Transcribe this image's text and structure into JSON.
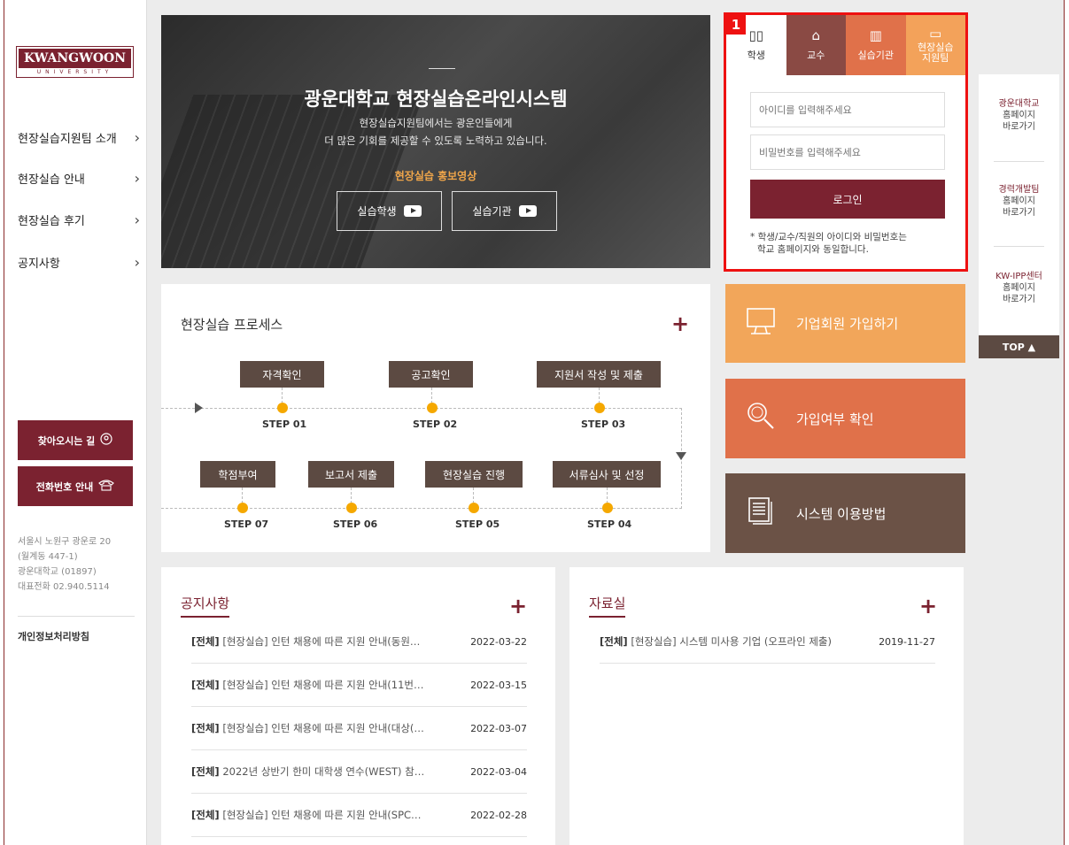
{
  "sidebar": {
    "logo_text": "KWANGWOON",
    "logo_sub": "UNIVERSITY",
    "nav": [
      "현장실습지원팀 소개",
      "현장실습 안내",
      "현장실습 후기",
      "공지사항"
    ],
    "directions_label": "찾아오시는 길",
    "phone_label": "전화번호 안내",
    "address": [
      "서울시 노원구 광운로 20",
      "(월계동 447-1)",
      "광운대학교 (01897)",
      "대표전화 02.940.5114"
    ],
    "privacy": "개인정보처리방침"
  },
  "hero": {
    "title": "광운대학교 현장실습온라인시스템",
    "sub1": "현장실습지원팀에서는 광운인들에게",
    "sub2": "더 많은 기회를 제공할 수 있도록 노력하고 있습니다.",
    "promo": "현장실습 홍보영상",
    "btn_student": "실습학생",
    "btn_org": "실습기관"
  },
  "login": {
    "badge": "1",
    "tabs": [
      {
        "label": "학생",
        "icon": "book-icon",
        "color": "#ffffff"
      },
      {
        "label": "교수",
        "icon": "graduation-cap-icon",
        "color": "#8a4a44"
      },
      {
        "label": "실습기관",
        "icon": "building-icon",
        "color": "#e0714a"
      },
      {
        "label": "현장실습\n지원팀",
        "icon": "monitor-icon",
        "color": "#f3a25a"
      }
    ],
    "id_placeholder": "아이디를 입력해주세요",
    "pw_placeholder": "비밀번호를 입력해주세요",
    "login_button": "로그인",
    "note1": "* 학생/교수/직원의 아이디와 비밀번호는",
    "note2": "학교 홈페이지와 동일합니다."
  },
  "quick": [
    {
      "title": "광운대학교",
      "l2": "홈페이지",
      "l3": "바로가기"
    },
    {
      "title": "경력개발팀",
      "l2": "홈페이지",
      "l3": "바로가기"
    },
    {
      "title": "KW-IPP센터",
      "l2": "홈페이지",
      "l3": "바로가기"
    }
  ],
  "top_label": "TOP ▲",
  "process": {
    "title": "현장실습 프로세스",
    "row1": [
      {
        "name": "자격확인",
        "step": "STEP 01"
      },
      {
        "name": "공고확인",
        "step": "STEP 02"
      },
      {
        "name": "지원서 작성 및 제출",
        "step": "STEP 03"
      }
    ],
    "row2": [
      {
        "name": "학점부여",
        "step": "STEP 07"
      },
      {
        "name": "보고서 제출",
        "step": "STEP 06"
      },
      {
        "name": "현장실습 진행",
        "step": "STEP 05"
      },
      {
        "name": "서류심사 및 선정",
        "step": "STEP 04"
      }
    ]
  },
  "actions": [
    {
      "label": "기업회원 가입하기",
      "icon": "monitor-icon",
      "color": "#f2a65a"
    },
    {
      "label": "가입여부 확인",
      "icon": "search-icon",
      "color": "#e0714a"
    },
    {
      "label": "시스템 이용방법",
      "icon": "document-icon",
      "color": "#6b5246"
    }
  ],
  "notices": {
    "title": "공지사항",
    "items": [
      {
        "tag": "[전체]",
        "text": " [현장실습] 인턴 채용에 따른 지원 안내(동원…",
        "date": "2022-03-22"
      },
      {
        "tag": "[전체]",
        "text": " [현장실습] 인턴 채용에 따른 지원 안내(11번…",
        "date": "2022-03-15"
      },
      {
        "tag": "[전체]",
        "text": " [현장실습] 인턴 채용에 따른 지원 안내(대상(…",
        "date": "2022-03-07"
      },
      {
        "tag": "[전체]",
        "text": " 2022년 상반기 한미 대학생 연수(WEST) 참…",
        "date": "2022-03-04"
      },
      {
        "tag": "[전체]",
        "text": " [현장실습] 인턴 채용에 따른 지원 안내(SPC…",
        "date": "2022-02-28"
      }
    ]
  },
  "library": {
    "title": "자료실",
    "items": [
      {
        "tag": "[전체]",
        "text": " [현장실습] 시스템 미사용 기업 (오프라인 제출)",
        "date": "2019-11-27"
      }
    ]
  }
}
